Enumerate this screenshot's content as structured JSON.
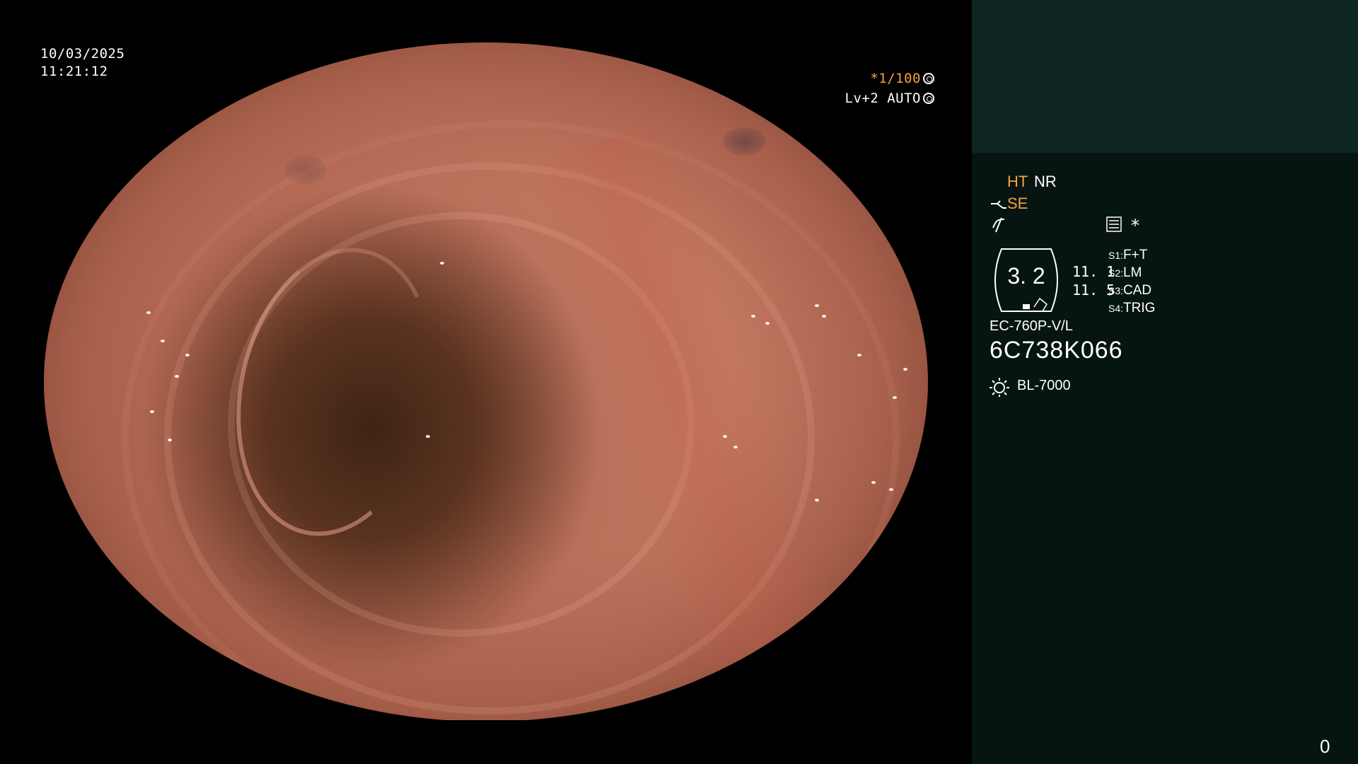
{
  "view": {
    "date": "10/03/2025",
    "time": "11:21:12",
    "shutter": "*1/100",
    "level": "Lv+2 AUTO"
  },
  "panel": {
    "ht": "HT",
    "nr": "NR",
    "se": "SE",
    "badge_value": "3. 2",
    "value_1": "11. 1",
    "value_2": "11. 5",
    "presets": [
      {
        "key": "S1:",
        "value": "F+T"
      },
      {
        "key": "S2:",
        "value": "LM"
      },
      {
        "key": "S3:",
        "value": "CAD"
      },
      {
        "key": "S4:",
        "value": "TRIG"
      }
    ],
    "scope_model": "EC-760P-V/L",
    "scope_serial": "6C738K066",
    "light_source": "BL-7000",
    "counter": "0",
    "asterisk": "*"
  },
  "colors": {
    "accent_orange": "#f2a23c",
    "panel_bg": "#071512",
    "panel_top_bg": "#0f2724"
  },
  "icons": [
    "aperture-icon",
    "iris-icon",
    "scope-tip-icon",
    "fiber-icon",
    "menu-icon",
    "light-source-icon"
  ]
}
